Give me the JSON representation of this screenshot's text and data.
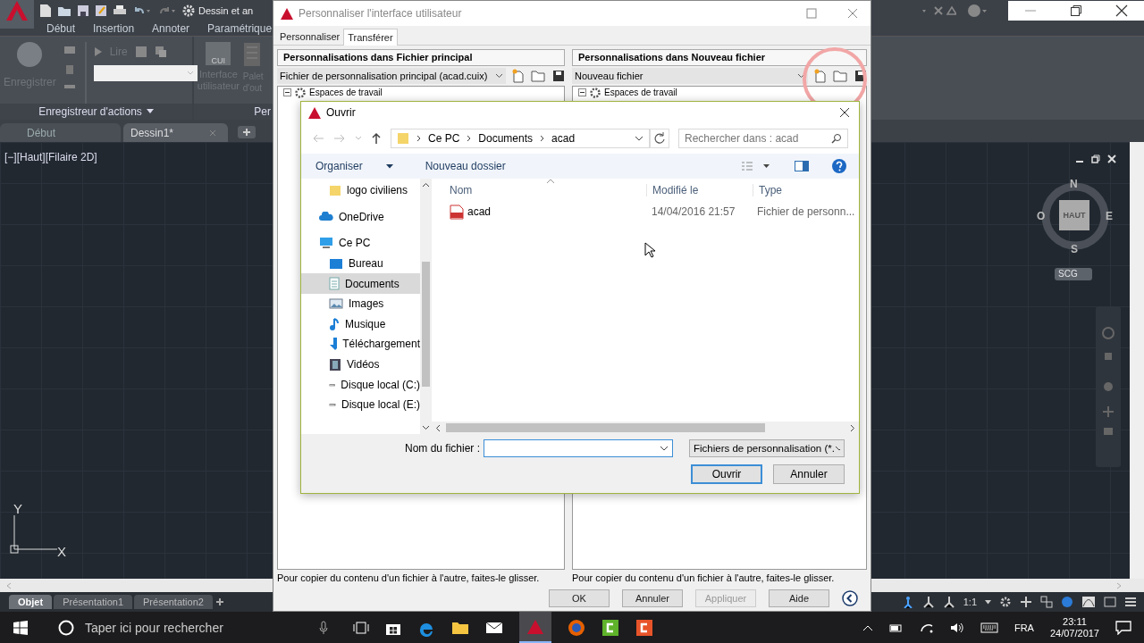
{
  "autocad": {
    "drawing_title": "Dessin et an",
    "ribbon_tabs": [
      {
        "label": "Début"
      },
      {
        "label": "Insertion"
      },
      {
        "label": "Annoter"
      },
      {
        "label": "Paramétrique"
      }
    ],
    "ribbon": {
      "record_label": "Enregistrer",
      "play_label": "Lire",
      "panel_title": "Enregistreur d'actions",
      "cui_icon_text": "CUI",
      "cui_label": "Interface utilisateur",
      "palette_label": "Palet d'out",
      "next_panel_title": "Per"
    },
    "doc_tabs": [
      {
        "label": "Début",
        "selected": false
      },
      {
        "label": "Dessin1*",
        "selected": true
      }
    ],
    "viewport_label": "[−][Haut][Filaire 2D]",
    "viewcube": {
      "north": "N",
      "south": "S",
      "east": "E",
      "west": "O",
      "face": "HAUT",
      "ucs": "SCG"
    },
    "axes": {
      "y": "Y",
      "x": "X"
    },
    "layout_tabs": [
      {
        "label": "Objet",
        "selected": true
      },
      {
        "label": "Présentation1",
        "selected": false
      },
      {
        "label": "Présentation2",
        "selected": false
      }
    ],
    "scale": "1:1"
  },
  "cui_window": {
    "title": "Personnaliser l'interface utilisateur",
    "tabs": [
      {
        "label": "Personnaliser",
        "selected": false
      },
      {
        "label": "Transférer",
        "selected": true
      }
    ],
    "panes": [
      {
        "header": "Personnalisations dans Fichier principal",
        "file": "Fichier de personnalisation principal (acad.cuix)",
        "tree_item": "Espaces de travail",
        "hint": "Pour copier du contenu d'un fichier à l'autre, faites-le glisser."
      },
      {
        "header": "Personnalisations dans Nouveau fichier",
        "file": "Nouveau fichier",
        "tree_item": "Espaces de travail",
        "hint": "Pour copier du contenu d'un fichier à l'autre, faites-le glisser."
      }
    ],
    "buttons": [
      {
        "label": "OK",
        "disabled": false
      },
      {
        "label": "Annuler",
        "disabled": false
      },
      {
        "label": "Appliquer",
        "disabled": true
      },
      {
        "label": "Aide",
        "disabled": false
      }
    ]
  },
  "open_dialog": {
    "title": "Ouvrir",
    "path": [
      "Ce PC",
      "Documents",
      "acad"
    ],
    "search": {
      "placeholder": "Rechercher dans : acad"
    },
    "toolbar": [
      "Organiser",
      "Nouveau dossier"
    ],
    "nav_overflow": [
      {
        "label": "logo civiliens",
        "kind": "folder",
        "selected": false
      }
    ],
    "nav": [
      {
        "label": "OneDrive",
        "kind": "cloud",
        "selected": false
      },
      {
        "label": "Ce PC",
        "kind": "pc",
        "selected": false,
        "children": [
          {
            "label": "Bureau",
            "kind": "desktop",
            "selected": false
          },
          {
            "label": "Documents",
            "kind": "documents",
            "selected": true
          },
          {
            "label": "Images",
            "kind": "images",
            "selected": false
          },
          {
            "label": "Musique",
            "kind": "music",
            "selected": false
          },
          {
            "label": "Téléchargement",
            "kind": "download",
            "selected": false
          },
          {
            "label": "Vidéos",
            "kind": "videos",
            "selected": false
          },
          {
            "label": "Disque local (C:)",
            "kind": "drive",
            "selected": false
          },
          {
            "label": "Disque local (E:)",
            "kind": "drive",
            "selected": false
          }
        ]
      }
    ],
    "columns": [
      "Nom",
      "Modifié le",
      "Type"
    ],
    "files": [
      {
        "name": "acad",
        "modified": "14/04/2016 21:57",
        "type": "Fichier de personn..."
      }
    ],
    "filename_label": "Nom du fichier :",
    "filter": "Fichiers de personnalisation (*.",
    "buttons": [
      {
        "label": "Ouvrir",
        "default": true
      },
      {
        "label": "Annuler",
        "default": false
      }
    ]
  },
  "taskbar": {
    "search_placeholder": "Taper ici pour rechercher",
    "language": "FRA",
    "time": "23:11",
    "date": "24/07/2017"
  }
}
